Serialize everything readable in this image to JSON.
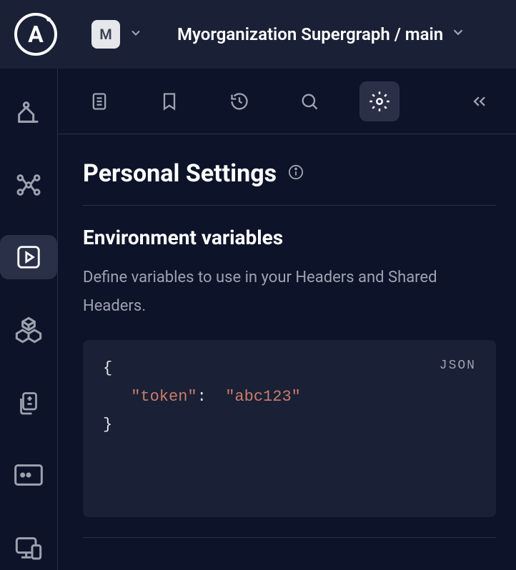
{
  "header": {
    "logo_letter": "A",
    "org_badge": "M",
    "breadcrumb": "Myorganization Supergraph / main"
  },
  "sidebar": {
    "items": [
      {
        "name": "observatory-icon",
        "active": false
      },
      {
        "name": "graph-icon",
        "active": false
      },
      {
        "name": "play-icon",
        "active": true
      },
      {
        "name": "boxes-icon",
        "active": false
      },
      {
        "name": "diff-icon",
        "active": false
      },
      {
        "name": "terminal-icon",
        "active": false
      },
      {
        "name": "devices-icon",
        "active": false
      }
    ]
  },
  "toolbar": {
    "items": [
      {
        "name": "document-icon"
      },
      {
        "name": "bookmark-icon"
      },
      {
        "name": "history-icon"
      },
      {
        "name": "search-icon"
      },
      {
        "name": "gear-icon",
        "active": true
      }
    ],
    "collapse_label": "collapse"
  },
  "page": {
    "title": "Personal Settings",
    "section_title": "Environment variables",
    "section_desc": "Define variables to use in your Headers and Shared Headers."
  },
  "code": {
    "badge": "JSON",
    "brace_open": "{",
    "brace_close": "}",
    "key": "\"token\"",
    "colon": ":",
    "value": "\"abc123\""
  }
}
